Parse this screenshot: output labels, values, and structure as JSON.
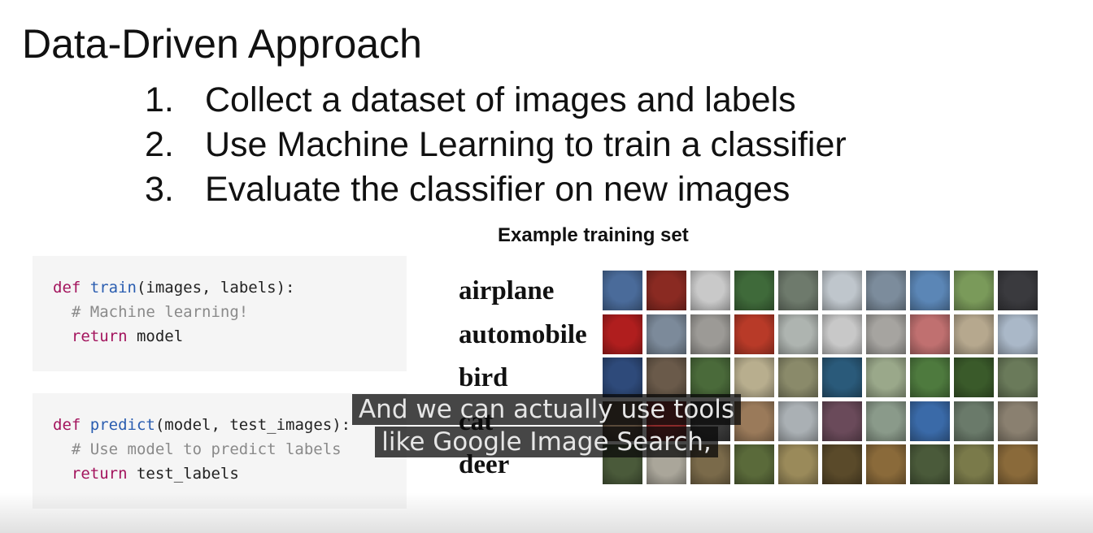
{
  "slide": {
    "title": "Data-Driven Approach",
    "steps": [
      {
        "num": "1.",
        "text": "Collect a dataset of images and labels"
      },
      {
        "num": "2.",
        "text": "Use Machine Learning to train a classifier"
      },
      {
        "num": "3.",
        "text": "Evaluate the classifier on new images"
      }
    ],
    "training_set_title": "Example training set"
  },
  "code": {
    "train": {
      "def": "def",
      "fn": "train",
      "args": "(images, labels):",
      "comment": "# Machine learning!",
      "return_kw": "return",
      "return_val": "model"
    },
    "predict": {
      "def": "def",
      "fn": "predict",
      "args": "(model, test_images):",
      "comment": "# Use model to predict labels",
      "return_kw": "return",
      "return_val": "test_labels"
    }
  },
  "classes": [
    {
      "label": "airplane",
      "colors": [
        "#4a6b9a",
        "#8a2a22",
        "#c9c9c9",
        "#3f6a3a",
        "#6e7a6c",
        "#bfc6cc",
        "#7c8c9c",
        "#5b86b6",
        "#7a9a5a",
        "#3a3a3e"
      ]
    },
    {
      "label": "automobile",
      "colors": [
        "#b01e1e",
        "#7c8a9a",
        "#9c9a96",
        "#b83a28",
        "#aeb4b0",
        "#c8c8c8",
        "#a6a4a0",
        "#c07070",
        "#b6a88e",
        "#aab8c8"
      ]
    },
    {
      "label": "bird",
      "colors": [
        "#2e4a7a",
        "#6a5a4a",
        "#4a6a3a",
        "#b8ae8e",
        "#8a8a6a",
        "#2a5a7a",
        "#9aa88a",
        "#4e7a3e",
        "#3a5a2a",
        "#6a7a5a"
      ]
    },
    {
      "label": "cat",
      "colors": [
        "#5a4a3a",
        "#8a2a2a",
        "#3a3a3a",
        "#9a7a5a",
        "#aab0b4",
        "#6a4a5a",
        "#8a9a8a",
        "#3a6aa8",
        "#6a7a6a",
        "#8a8070"
      ]
    },
    {
      "label": "deer",
      "colors": [
        "#4a5a3a",
        "#aaa69a",
        "#7a6a4a",
        "#5a6a3a",
        "#9a8a5a",
        "#5a4a2a",
        "#8a6a3a",
        "#4a5a3a",
        "#7a7a4a",
        "#8a6a3a"
      ]
    }
  ],
  "caption": {
    "line1": "And we can actually use tools",
    "line2": "like Google Image Search,"
  }
}
